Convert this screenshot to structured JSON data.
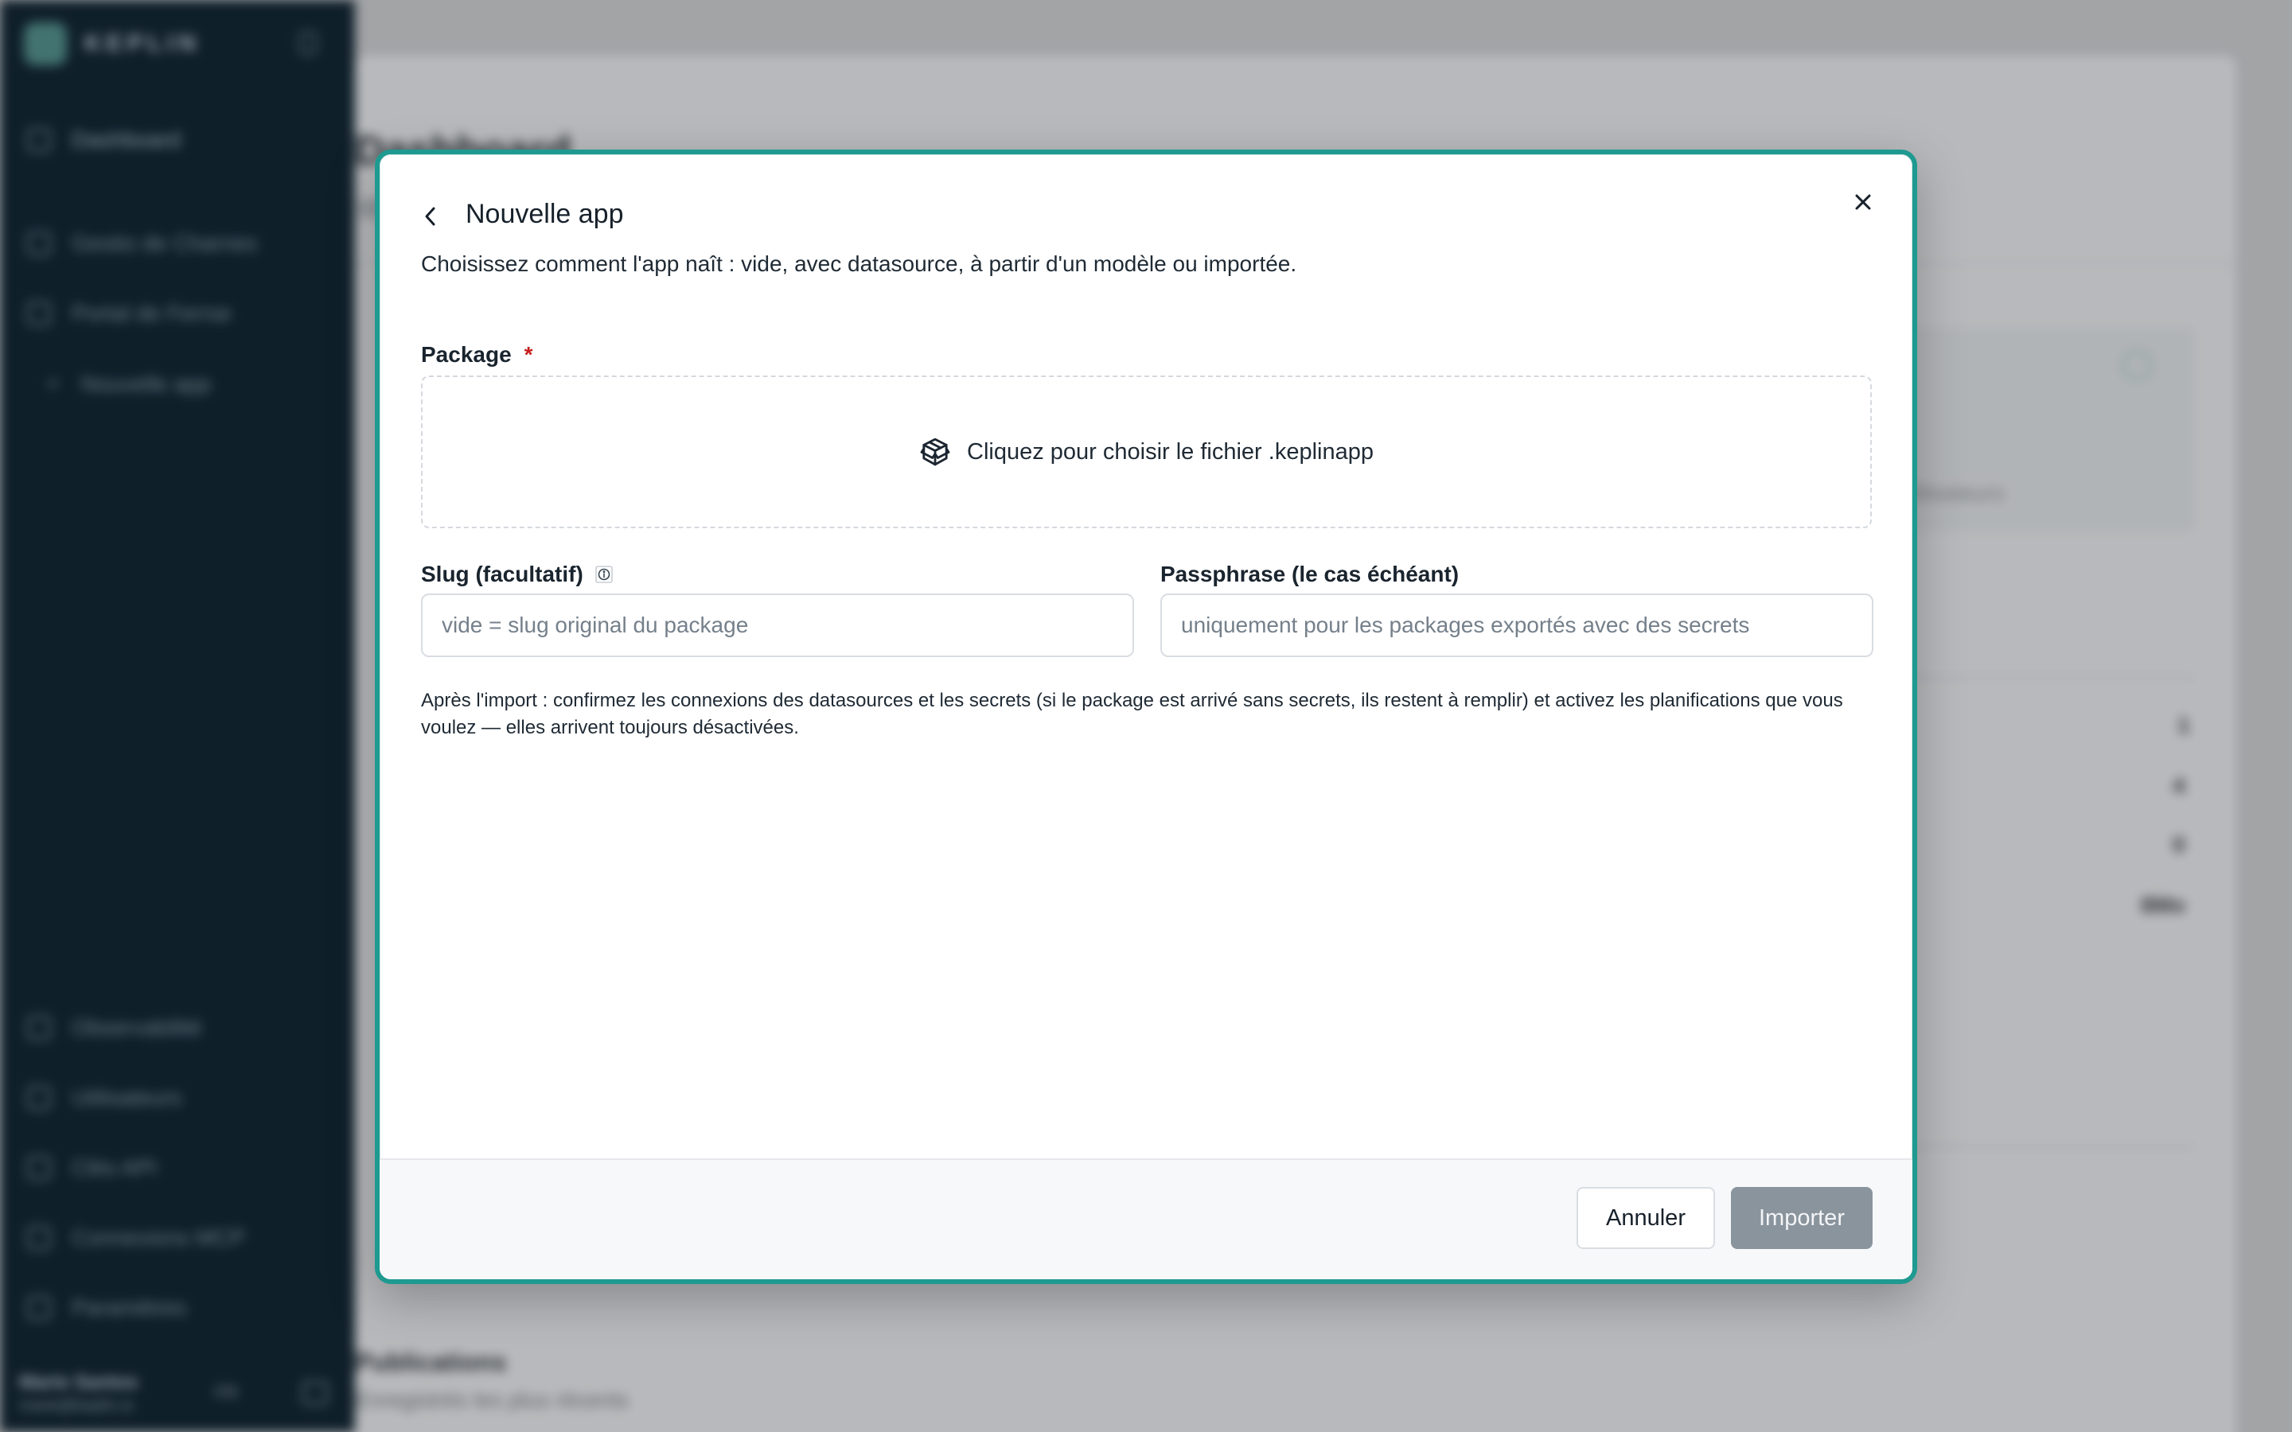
{
  "background": {
    "sidebar": {
      "brand": "KEPLIN",
      "items": [
        {
          "label": "Dashboard"
        },
        {
          "label": "Gestio de Charnes"
        },
        {
          "label": "Portal de Ferrse"
        },
        {
          "label": "Nouvelle app"
        }
      ],
      "bottom_items": [
        {
          "label": "Observabilité"
        },
        {
          "label": "Utilisateurs"
        },
        {
          "label": "Clés API"
        },
        {
          "label": "Connexions MCP"
        },
        {
          "label": "Paramètres"
        }
      ],
      "user_name": "Marie Santos",
      "user_email": "marie@keplin.io",
      "lang": "FR"
    },
    "page_title": "Dashboard",
    "panel_label": "Utilisateurs",
    "stats": [
      "1",
      "4",
      "0",
      "8Mo"
    ],
    "section_title": "Publications",
    "section_subtitle": "Enregistrés les plus récents"
  },
  "modal": {
    "title": "Nouvelle app",
    "description": "Choisissez comment l'app naît : vide, avec datasource, à partir d'un modèle ou importée.",
    "package": {
      "label": "Package",
      "required_mark": "*",
      "dropzone_text": "Cliquez pour choisir le fichier .keplinapp"
    },
    "slug": {
      "label": "Slug (facultatif)",
      "placeholder": "vide = slug original du package",
      "value": ""
    },
    "passphrase": {
      "label": "Passphrase (le cas échéant)",
      "placeholder": "uniquement pour les packages exportés avec des secrets",
      "value": ""
    },
    "help_text": "Après l'import : confirmez les connexions des datasources et les secrets (si le package est arrivé sans secrets, ils restent à remplir) et activez les planifications que vous voulez — elles arrivent toujours désactivées.",
    "buttons": {
      "cancel": "Annuler",
      "import": "Importer"
    }
  },
  "colors": {
    "accent": "#1e9a90",
    "sidebar_bg": "#0c1f2c",
    "required": "#c81e1e",
    "import_disabled": "#8a949d"
  }
}
